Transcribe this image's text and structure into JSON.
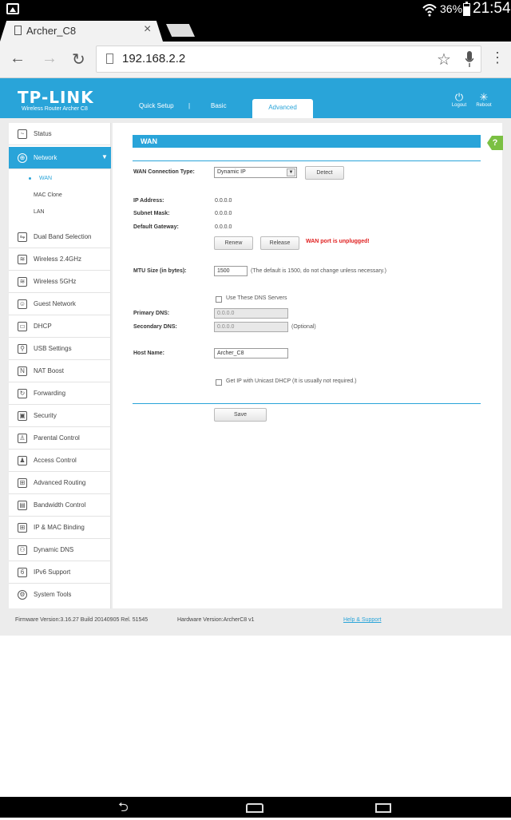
{
  "status_bar": {
    "battery": "36%",
    "time": "21:54"
  },
  "browser": {
    "tab_title": "Archer_C8",
    "url": "192.168.2.2"
  },
  "router": {
    "logo": "TP-LINK",
    "model": "Wireless Router Archer C8",
    "tabs": {
      "quick_setup": "Quick Setup",
      "separator": "|",
      "basic": "Basic",
      "advanced": "Advanced"
    },
    "logout": "Logout",
    "reboot": "Reboot",
    "accent_color": "#29a4d9"
  },
  "sidebar": {
    "items": [
      {
        "label": "Status",
        "icon": "status-icon"
      },
      {
        "label": "Network",
        "icon": "globe-icon"
      },
      {
        "label": "Dual Band Selection",
        "icon": "dual-band-icon"
      },
      {
        "label": "Wireless 2.4GHz",
        "icon": "wireless-icon"
      },
      {
        "label": "Wireless 5GHz",
        "icon": "wireless-icon"
      },
      {
        "label": "Guest Network",
        "icon": "guest-icon"
      },
      {
        "label": "DHCP",
        "icon": "dhcp-icon"
      },
      {
        "label": "USB Settings",
        "icon": "usb-icon"
      },
      {
        "label": "NAT Boost",
        "icon": "nat-icon"
      },
      {
        "label": "Forwarding",
        "icon": "forwarding-icon"
      },
      {
        "label": "Security",
        "icon": "lock-icon"
      },
      {
        "label": "Parental Control",
        "icon": "parental-icon"
      },
      {
        "label": "Access Control",
        "icon": "access-icon"
      },
      {
        "label": "Advanced Routing",
        "icon": "routing-icon"
      },
      {
        "label": "Bandwidth Control",
        "icon": "bandwidth-icon"
      },
      {
        "label": "IP & MAC Binding",
        "icon": "binding-icon"
      },
      {
        "label": "Dynamic DNS",
        "icon": "ddns-icon"
      },
      {
        "label": "IPv6 Support",
        "icon": "ipv6-icon"
      },
      {
        "label": "System Tools",
        "icon": "gear-icon"
      }
    ],
    "network_sub": [
      "WAN",
      "MAC Clone",
      "LAN"
    ]
  },
  "wan": {
    "title": "WAN",
    "connection_type_label": "WAN Connection Type:",
    "connection_type_value": "Dynamic IP",
    "detect": "Detect",
    "ip_label": "IP Address:",
    "ip_value": "0.0.0.0",
    "mask_label": "Subnet Mask:",
    "mask_value": "0.0.0.0",
    "gw_label": "Default Gateway:",
    "gw_value": "0.0.0.0",
    "renew": "Renew",
    "release": "Release",
    "warning": "WAN port is unplugged!",
    "mtu_label": "MTU Size (in bytes):",
    "mtu_value": "1500",
    "mtu_note": "(The default is 1500, do not change unless necessary.)",
    "use_dns": "Use These DNS Servers",
    "primary_dns_label": "Primary DNS:",
    "primary_dns_value": "0.0.0.0",
    "secondary_dns_label": "Secondary DNS:",
    "secondary_dns_value": "0.0.0.0",
    "optional": "(Optional)",
    "host_label": "Host Name:",
    "host_value": "Archer_C8",
    "unicast": "Get IP with Unicast DHCP (It is usually not required.)",
    "save": "Save"
  },
  "footer": {
    "firmware": "Firmware Version:3.16.27 Build 20140905 Rel. 51545",
    "hardware": "Hardware Version:ArcherC8 v1",
    "help": "Help & Support"
  }
}
